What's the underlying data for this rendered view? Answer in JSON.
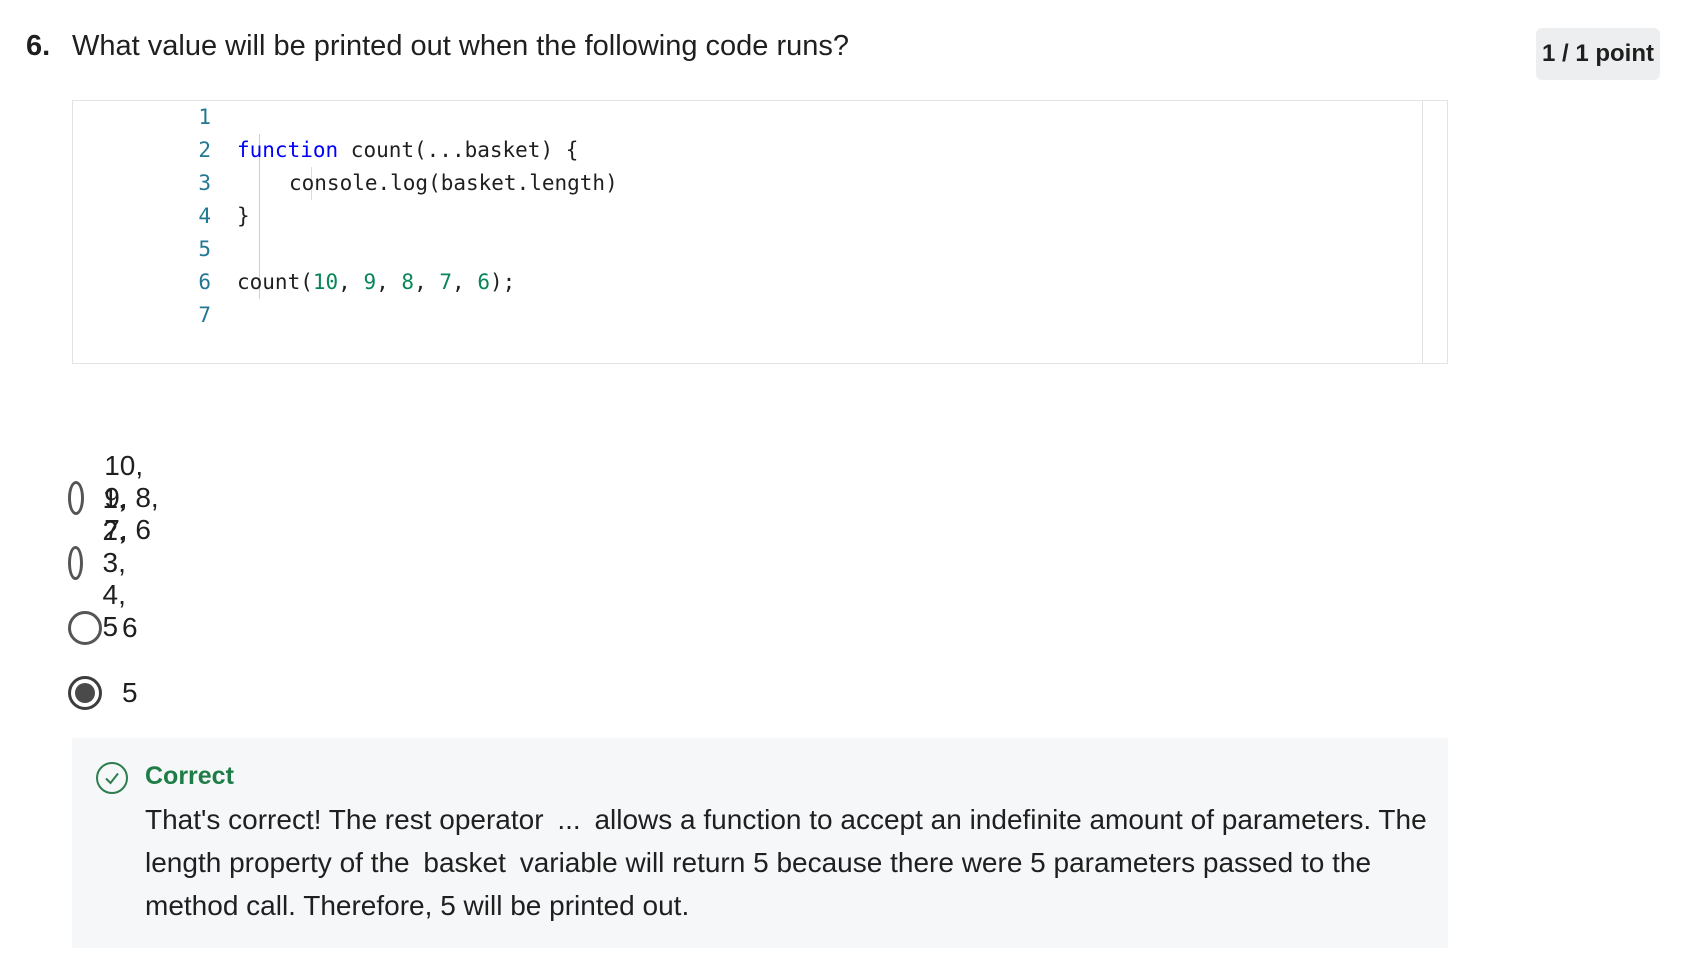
{
  "question": {
    "number": "6.",
    "text": "What value will be printed out when the following code runs?",
    "points": "1 / 1 point"
  },
  "code": {
    "line_numbers": [
      "1",
      "2",
      "3",
      "4",
      "5",
      "6",
      "7"
    ],
    "lines": [
      {
        "kw": "function",
        "rest": " count(...basket) {"
      },
      {
        "text": "console.log(basket.length)"
      },
      {
        "text": "}"
      },
      {
        "prefix": "count(",
        "n1": "10",
        "sep1": ", ",
        "n2": "9",
        "sep2": ", ",
        "n3": "8",
        "sep3": ", ",
        "n4": "7",
        "sep4": ", ",
        "n5": "6",
        "suffix": ");"
      }
    ]
  },
  "options": [
    {
      "label": "10, 9, 8, 7, 6",
      "selected": false
    },
    {
      "label": "1, 2, 3, 4, 5",
      "selected": false
    },
    {
      "label": "6",
      "selected": false
    },
    {
      "label": "5",
      "selected": true
    }
  ],
  "feedback": {
    "status": "Correct",
    "text_1": "That's correct! The rest operator",
    "code_1": "...",
    "text_2": "allows a function to accept an indefinite amount of parameters. The length property of the",
    "code_2": "basket",
    "text_3": "variable will return 5 because there were 5 parameters passed to the method call. Therefore, 5 will be printed out.",
    "success_color": "#1e7d46"
  },
  "icons": {
    "feedback_icon": "check-circle-icon"
  }
}
